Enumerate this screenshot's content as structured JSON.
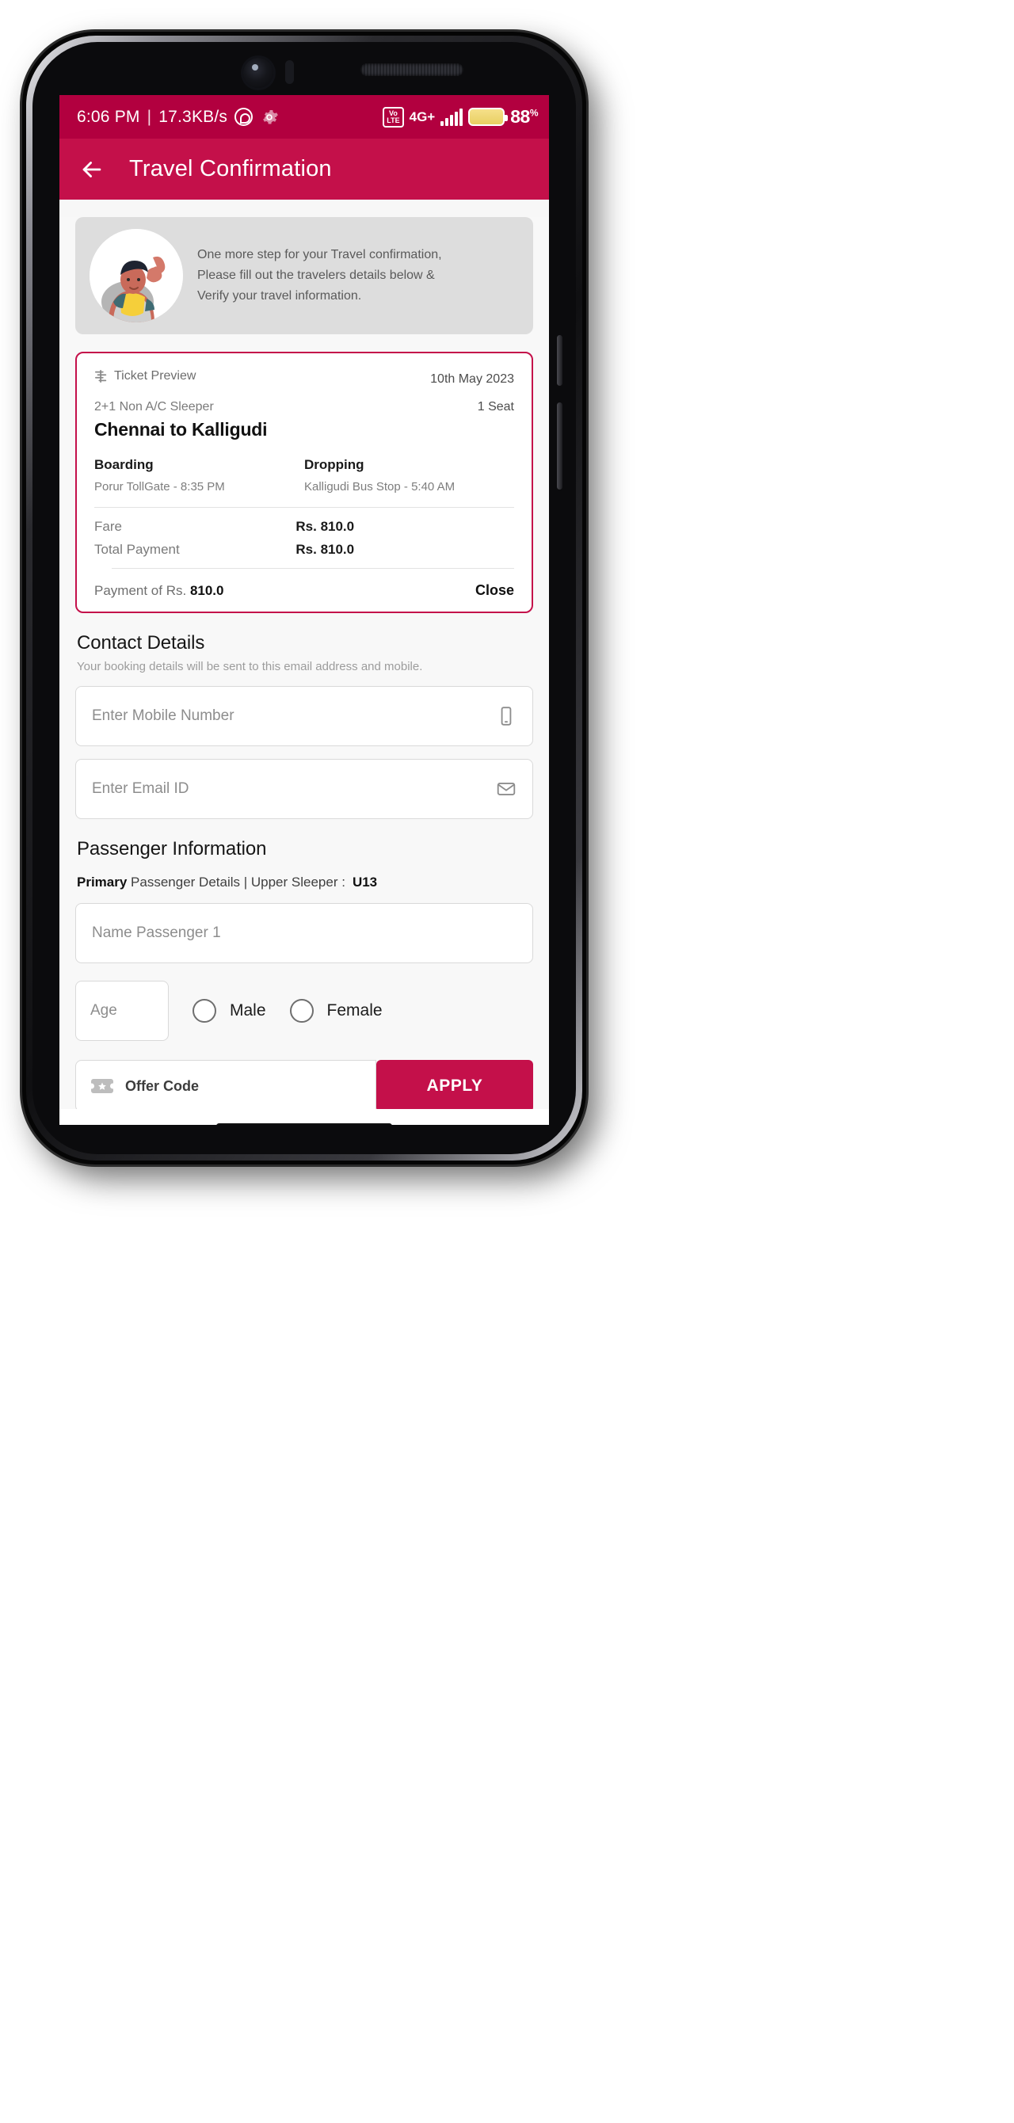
{
  "status_bar": {
    "time": "6:06 PM",
    "separator": "|",
    "data_speed": "17.3KB/s",
    "whatsapp_icon": "whatsapp-icon",
    "settings_icon": "gear-icon",
    "volte_top": "Vo",
    "volte_bottom": "LTE",
    "network": "4G+",
    "battery_percent": "88",
    "battery_percent_symbol": "%"
  },
  "app_bar": {
    "back_icon": "back-arrow-icon",
    "title": "Travel Confirmation"
  },
  "banner": {
    "line1": "One more step for your Travel confirmation,",
    "line2": "Please fill out the travelers details below &",
    "line3": "Verify your travel information."
  },
  "ticket": {
    "preview_label": "Ticket Preview",
    "date": "10th May 2023",
    "bus_type": "2+1 Non A/C Sleeper",
    "seat_count": "1 Seat",
    "route": "Chennai to Kalligudi",
    "boarding_head": "Boarding",
    "boarding_value": "Porur TollGate - 8:35 PM",
    "dropping_head": "Dropping",
    "dropping_value": "Kalligudi Bus Stop - 5:40 AM",
    "fare_label": "Fare",
    "fare_value": "Rs. 810.0",
    "total_label": "Total Payment",
    "total_value": "Rs. 810.0",
    "payment_prefix": "Payment of Rs. ",
    "payment_amount": "810.0",
    "close_label": "Close"
  },
  "contact": {
    "title": "Contact Details",
    "subtitle": "Your booking details will be sent to this email address and mobile.",
    "mobile_placeholder": "Enter Mobile Number",
    "mobile_value": "",
    "mobile_icon": "mobile-phone-icon",
    "email_placeholder": "Enter Email ID",
    "email_value": "",
    "email_icon": "envelope-icon"
  },
  "passenger": {
    "title": "Passenger Information",
    "primary_label": "Primary",
    "detail_label": " Passenger Details | Upper Sleeper :",
    "seat_number": "U13",
    "name_placeholder": "Name Passenger 1",
    "name_value": "",
    "age_placeholder": "Age",
    "age_value": "",
    "male_label": "Male",
    "female_label": "Female"
  },
  "offer": {
    "icon": "offer-ticket-icon",
    "placeholder": "Offer Code",
    "value": "",
    "apply_label": "APPLY"
  },
  "colors": {
    "brand": "#c4104a",
    "status_bar": "#b2003f",
    "banner_bg": "#dddddd"
  }
}
